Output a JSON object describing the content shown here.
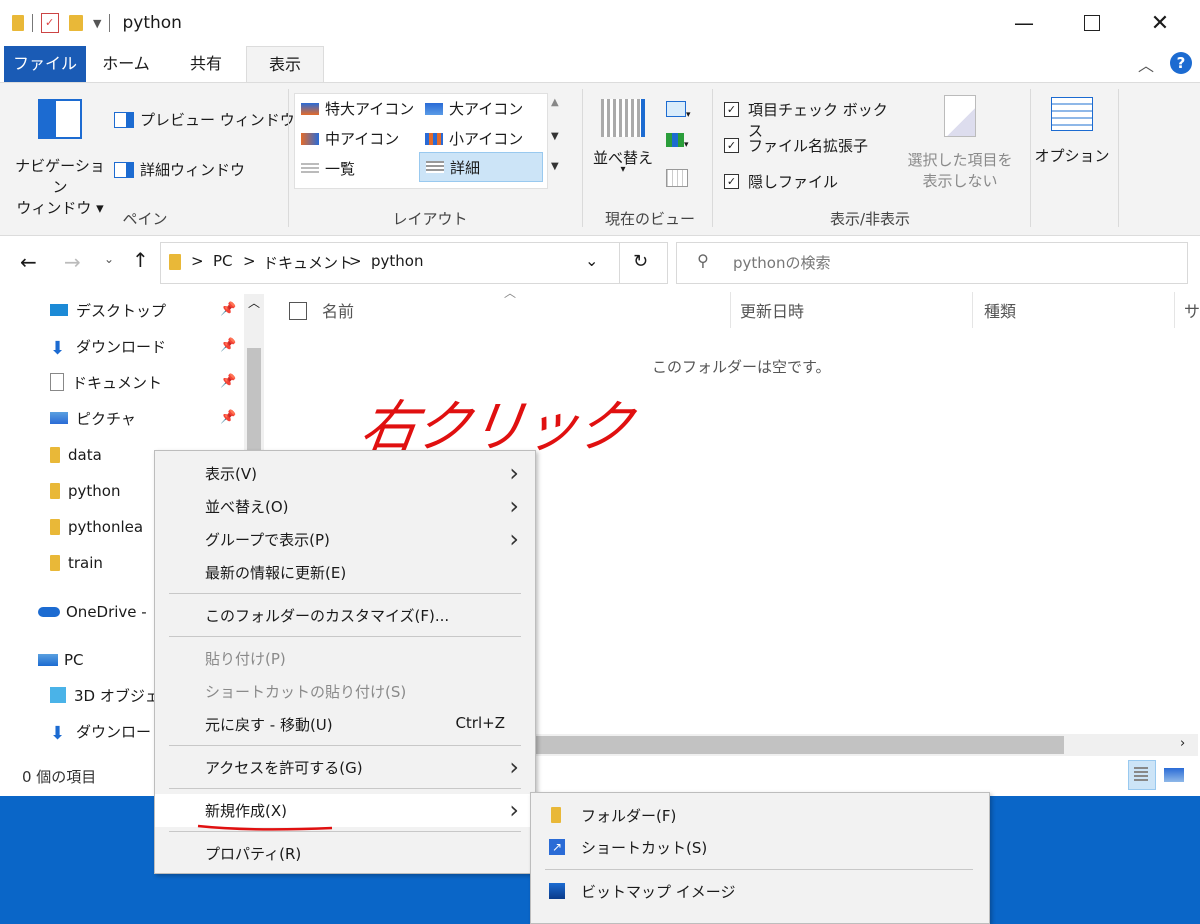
{
  "window": {
    "title": "python"
  },
  "titlebar": {
    "controls": [
      "—",
      "☐",
      "✕"
    ]
  },
  "tabs": [
    {
      "label": "ファイル",
      "active": false,
      "file": true
    },
    {
      "label": "ホーム"
    },
    {
      "label": "共有"
    },
    {
      "label": "表示",
      "active": true
    }
  ],
  "ribbon": {
    "pane": {
      "nav_pane_label_1": "ナビゲーション",
      "nav_pane_label_2": "ウィンドウ ▾",
      "preview": "プレビュー ウィンドウ",
      "details": "詳細ウィンドウ",
      "group": "ペイン"
    },
    "layout": {
      "items": [
        "特大アイコン",
        "大アイコン",
        "中アイコン",
        "小アイコン",
        "一覧",
        "詳細"
      ],
      "selected": "詳細",
      "group": "レイアウト"
    },
    "current_view": {
      "sort_1": "並べ替え",
      "sort_2": "▾",
      "group": "現在のビュー"
    },
    "show_hide": {
      "checkboxes": [
        "項目チェック ボックス",
        "ファイル名拡張子",
        "隠しファイル"
      ],
      "hide_selected_1": "選択した項目を",
      "hide_selected_2": "表示しない",
      "group": "表示/非表示"
    },
    "options": "オプション"
  },
  "address": {
    "path": [
      "PC",
      "ドキュメント",
      "python"
    ],
    "sep": ">",
    "search_placeholder": "pythonの検索"
  },
  "nav": {
    "quick": [
      {
        "label": "デスクトップ",
        "icon": "desktop-icon",
        "pinned": true
      },
      {
        "label": "ダウンロード",
        "icon": "download-icon",
        "pinned": true
      },
      {
        "label": "ドキュメント",
        "icon": "document-icon",
        "pinned": true
      },
      {
        "label": "ピクチャ",
        "icon": "pictures-icon",
        "pinned": true
      },
      {
        "label": "data",
        "icon": "folder-icon"
      },
      {
        "label": "python",
        "icon": "folder-icon"
      },
      {
        "label": "pythonlea",
        "icon": "folder-icon"
      },
      {
        "label": "train",
        "icon": "folder-icon"
      }
    ],
    "onedrive": "OneDrive -",
    "pc": "PC",
    "pc_items": [
      {
        "label": "3D オブジェ",
        "icon": "3d-objects-icon"
      },
      {
        "label": "ダウンロード",
        "icon": "download-icon"
      }
    ]
  },
  "columns": [
    "名前",
    "更新日時",
    "種類",
    "サ"
  ],
  "empty_message": "このフォルダーは空です。",
  "status": "0 個の項目",
  "annotation": "右クリック",
  "context_menu": {
    "items": [
      {
        "label": "表示(V)",
        "submenu": true
      },
      {
        "label": "並べ替え(O)",
        "submenu": true
      },
      {
        "label": "グループで表示(P)",
        "submenu": true
      },
      {
        "label": "最新の情報に更新(E)"
      },
      {
        "sep": true
      },
      {
        "label": "このフォルダーのカスタマイズ(F)..."
      },
      {
        "sep": true
      },
      {
        "label": "貼り付け(P)",
        "disabled": true
      },
      {
        "label": "ショートカットの貼り付け(S)",
        "disabled": true
      },
      {
        "label": "元に戻す - 移動(U)",
        "shortcut": "Ctrl+Z"
      },
      {
        "sep": true
      },
      {
        "label": "アクセスを許可する(G)",
        "submenu": true
      },
      {
        "sep": true
      },
      {
        "label": "新規作成(X)",
        "submenu": true,
        "highlighted": true
      },
      {
        "sep": true
      },
      {
        "label": "プロパティ(R)"
      }
    ]
  },
  "submenu": {
    "items": [
      {
        "label": "フォルダー(F)",
        "icon": "folder-icon"
      },
      {
        "label": "ショートカット(S)",
        "icon": "shortcut-icon"
      },
      {
        "sep": true
      },
      {
        "label": "ビットマップ イメージ",
        "icon": "bitmap-icon"
      }
    ]
  },
  "colors": {
    "accent": "#1c6bd1",
    "folder": "#e9b838",
    "annotation": "#e01010"
  }
}
